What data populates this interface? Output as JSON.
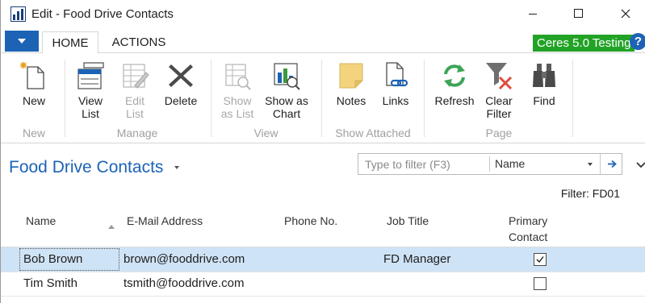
{
  "window": {
    "title": "Edit - Food Drive Contacts"
  },
  "tabs": {
    "home": "HOME",
    "actions": "ACTIONS"
  },
  "company_badge": "Ceres 5.0 Testing",
  "help_glyph": "?",
  "ribbon": {
    "groups": {
      "new": "New",
      "manage": "Manage",
      "view": "View",
      "show_attached": "Show Attached",
      "page": "Page"
    },
    "buttons": {
      "new": [
        "New"
      ],
      "view_list": [
        "View",
        "List"
      ],
      "edit_list": [
        "Edit",
        "List"
      ],
      "delete": [
        "Delete"
      ],
      "show_as_list": [
        "Show",
        "as List"
      ],
      "show_as_chart": [
        "Show as",
        "Chart"
      ],
      "notes": [
        "Notes"
      ],
      "links": [
        "Links"
      ],
      "refresh": [
        "Refresh"
      ],
      "clear_filter": [
        "Clear",
        "Filter"
      ],
      "find": [
        "Find"
      ]
    }
  },
  "page": {
    "title": "Food Drive Contacts",
    "filter_placeholder": "Type to filter (F3)",
    "filter_field": "Name",
    "filter_status": "Filter: FD01"
  },
  "table": {
    "headers": {
      "name": "Name",
      "email": "E-Mail Address",
      "phone": "Phone No.",
      "job_title": "Job Title",
      "primary_contact": [
        "Primary",
        "Contact"
      ]
    },
    "rows": [
      {
        "name": "Bob Brown",
        "email": "brown@fooddrive.com",
        "phone": "",
        "job_title": "FD Manager",
        "primary_contact": true,
        "selected": true
      },
      {
        "name": "Tim Smith",
        "email": "tsmith@fooddrive.com",
        "phone": "",
        "job_title": "",
        "primary_contact": false,
        "selected": false
      }
    ]
  },
  "colors": {
    "accent": "#1c63b6",
    "badge": "#22a326",
    "selected_row": "#cfe3f6",
    "disabled_text": "#a8a8a8"
  },
  "icons": {
    "app": "dynamics-nav-icon",
    "new": "new-document-icon",
    "view_list": "view-list-icon",
    "edit_list": "edit-list-icon",
    "delete": "delete-x-icon",
    "show_as_list": "show-as-list-icon",
    "show_as_chart": "chart-icon",
    "notes": "note-icon",
    "links": "link-icon",
    "refresh": "refresh-icon",
    "clear_filter": "clear-filter-icon",
    "find": "binoculars-icon"
  }
}
